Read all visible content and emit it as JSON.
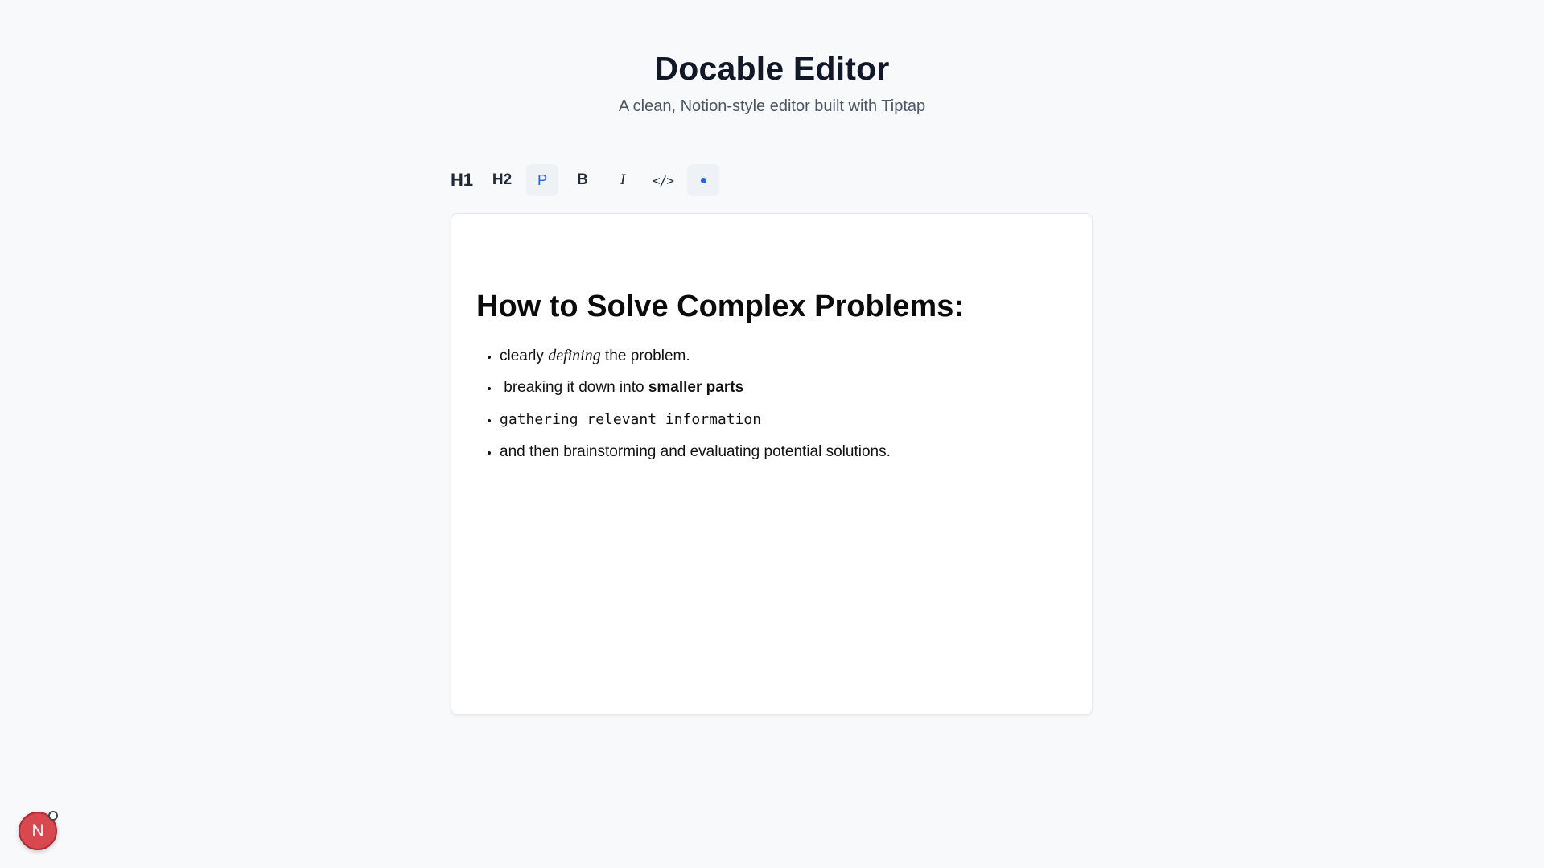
{
  "header": {
    "title": "Docable Editor",
    "subtitle": "A clean, Notion-style editor built with Tiptap"
  },
  "toolbar": {
    "h1_label": "H1",
    "h2_label": "H2",
    "paragraph_label": "P",
    "bold_label": "B",
    "italic_label": "I",
    "code_label": "</>",
    "active_button": "paragraph",
    "accent_color": "#2563eb"
  },
  "document": {
    "heading": "How to Solve Complex Problems:",
    "items": [
      {
        "prefix": "clearly ",
        "italic": "defining",
        "suffix": " the problem."
      },
      {
        "prefix": " breaking it down into ",
        "bold": "smaller parts"
      },
      {
        "code": "gathering relevant information"
      },
      {
        "text": "and then brainstorming and evaluating potential solutions."
      }
    ]
  },
  "avatar": {
    "initial": "N",
    "color": "#d9484f"
  }
}
